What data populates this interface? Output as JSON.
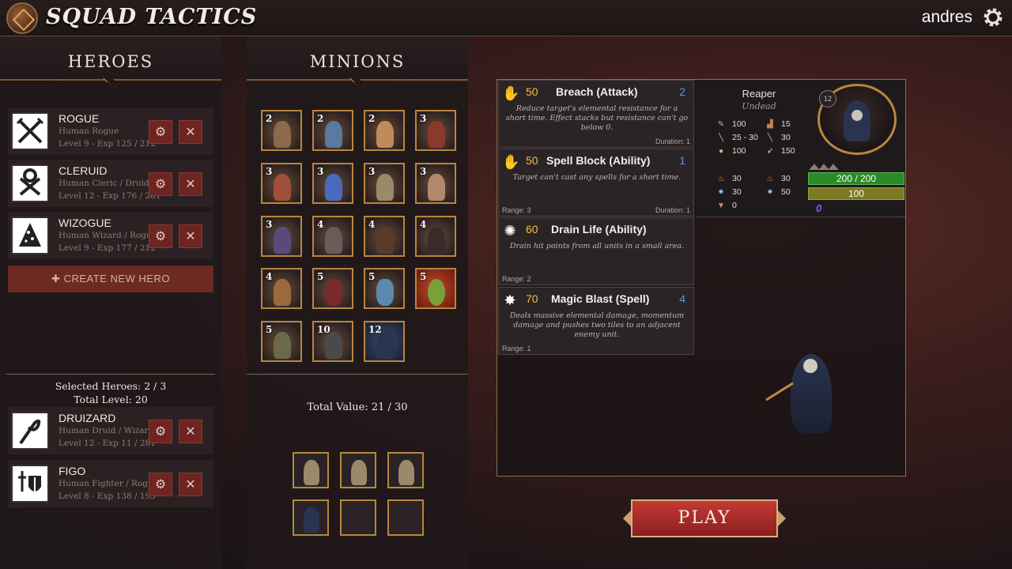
{
  "app": {
    "title": "SQUAD TACTICS",
    "username": "andres"
  },
  "heroes": {
    "header": "HEROES",
    "list": [
      {
        "name": "ROGUE",
        "class": "Human Rogue",
        "level_exp": "Level 9 - Exp 125 / 212",
        "icon": "crossed-daggers-icon"
      },
      {
        "name": "CLERUID",
        "class": "Human Cleric / Druid",
        "level_exp": "Level 12 - Exp 176 / 281",
        "icon": "ankh-cross-icon"
      },
      {
        "name": "WIZOGUE",
        "class": "Human Wizard / Rogue",
        "level_exp": "Level 9 - Exp 177 / 212",
        "icon": "wizard-hat-icon"
      }
    ],
    "create_label": "CREATE NEW HERO",
    "selected_label": "Selected Heroes: 2 / 3",
    "total_level_label": "Total Level: 20",
    "selected": [
      {
        "name": "DRUIZARD",
        "class": "Human Druid / Wizard",
        "level_exp": "Level 12 - Exp 11 / 281",
        "icon": "swirl-staff-icon"
      },
      {
        "name": "FIGO",
        "class": "Human Fighter / Rogue",
        "level_exp": "Level 8 - Exp 138 / 193",
        "icon": "sword-shield-icon"
      }
    ]
  },
  "minions": {
    "header": "MINIONS",
    "levels": [
      "2",
      "2",
      "2",
      "3",
      "3",
      "3",
      "3",
      "3",
      "3",
      "4",
      "4",
      "4",
      "4",
      "5",
      "5",
      "5",
      "5",
      "10",
      "12"
    ],
    "total_value_label": "Total Value: 21 / 30"
  },
  "detail": {
    "abilities": [
      {
        "cost": "50",
        "name": "Breach (Attack)",
        "num": "2",
        "desc": "Reduce target's elemental resistance for a short time. Effect stacks but resistance can't go below 0.",
        "range": "",
        "duration": "Duration: 1",
        "icon": "claw-icon"
      },
      {
        "cost": "50",
        "name": "Spell Block (Ability)",
        "num": "1",
        "desc": "Target can't cast any spells for a short time.",
        "range": "Range: 3",
        "duration": "Duration: 1",
        "icon": "open-hand-icon"
      },
      {
        "cost": "60",
        "name": "Drain Life (Ability)",
        "num": "",
        "desc": "Drain hit points from all units in a small area.",
        "range": "Range: 2",
        "duration": "",
        "icon": "burst-icon"
      },
      {
        "cost": "70",
        "name": "Magic Blast (Spell)",
        "num": "4",
        "desc": "Deals massive elemental damage, momentum damage and pushes two tiles to an adjacent enemy unit.",
        "range": "Range: 1",
        "duration": "",
        "icon": "blast-icon"
      }
    ],
    "unit": {
      "name": "Reaper",
      "type": "Undead",
      "level": "12",
      "stats": [
        "100",
        "15",
        "25 - 30",
        "30",
        "100",
        "150"
      ],
      "resists": [
        "30",
        "30",
        "30",
        "50",
        "0"
      ],
      "hp": "200 / 200",
      "energy": "100",
      "counter": "0"
    }
  },
  "play_label": "PLAY",
  "colors": {
    "accent_gold": "#b8863c",
    "play_red": "#c43a34",
    "hp_green": "#3a9a2a",
    "energy_olive": "#7a7a22"
  }
}
